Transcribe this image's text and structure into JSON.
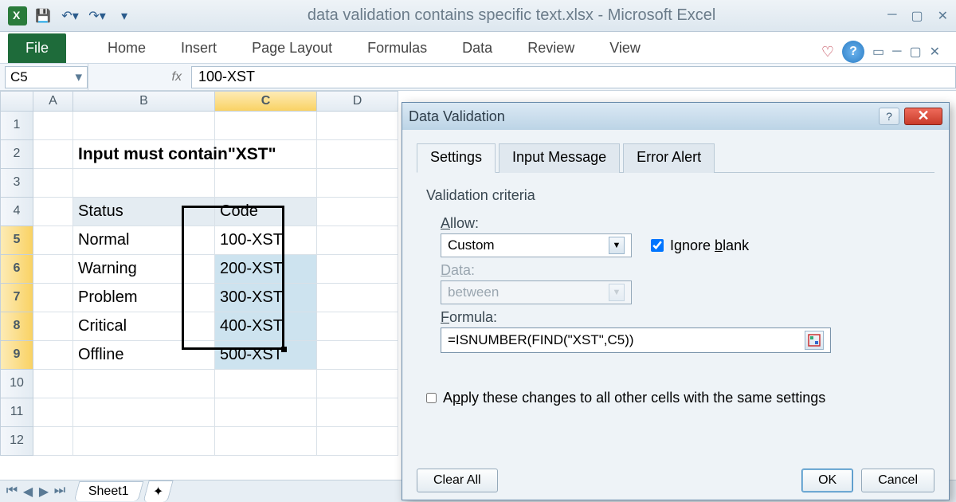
{
  "window": {
    "title": "data validation contains specific text.xlsx  -  Microsoft Excel"
  },
  "ribbon": {
    "file": "File",
    "tabs": [
      "Home",
      "Insert",
      "Page Layout",
      "Formulas",
      "Data",
      "Review",
      "View"
    ]
  },
  "namebox": "C5",
  "fx": "fx",
  "formula": "100-XST",
  "columns": [
    "A",
    "B",
    "C",
    "D"
  ],
  "rows": [
    "1",
    "2",
    "3",
    "4",
    "5",
    "6",
    "7",
    "8",
    "9",
    "10",
    "11",
    "12"
  ],
  "selectedRows": [
    "5",
    "6",
    "7",
    "8",
    "9"
  ],
  "selectedCol": "C",
  "sheet": {
    "title": "Input must contain\"XST\"",
    "headers": {
      "b": "Status",
      "c": "Code"
    },
    "data": [
      {
        "b": "Normal",
        "c": "100-XST"
      },
      {
        "b": "Warning",
        "c": "200-XST"
      },
      {
        "b": "Problem",
        "c": "300-XST"
      },
      {
        "b": "Critical",
        "c": "400-XST"
      },
      {
        "b": "Offline",
        "c": "500-XST"
      }
    ]
  },
  "sheetTab": "Sheet1",
  "dialog": {
    "title": "Data Validation",
    "tabs": [
      "Settings",
      "Input Message",
      "Error Alert"
    ],
    "criteria_label": "Validation criteria",
    "allow_label": "Allow:",
    "allow_value": "Custom",
    "ignore_blank": "Ignore blank",
    "data_label": "Data:",
    "data_value": "between",
    "formula_label": "Formula:",
    "formula_value": "=ISNUMBER(FIND(\"XST\",C5))",
    "apply_label": "Apply these changes to all other cells with the same settings",
    "clear": "Clear All",
    "ok": "OK",
    "cancel": "Cancel"
  }
}
